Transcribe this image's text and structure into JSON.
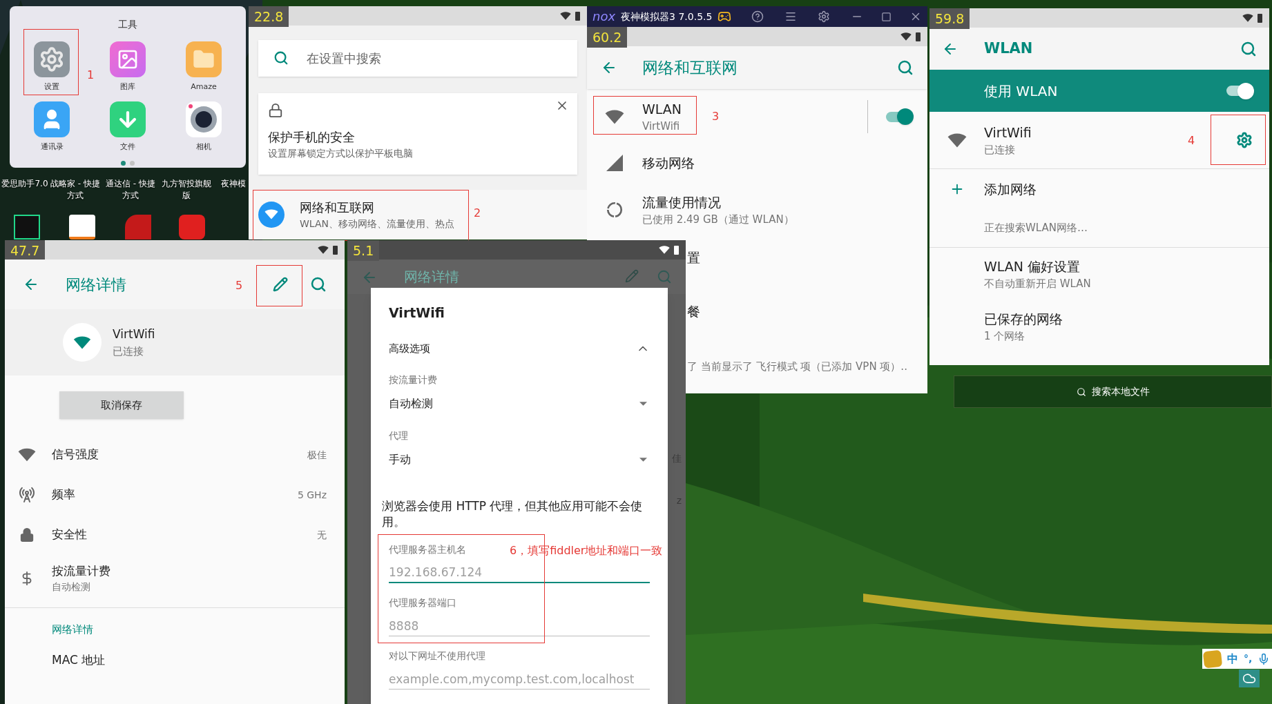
{
  "desktop": {
    "icon_labels": [
      "爱思助手7.0",
      "战略家 - 快捷方式",
      "通达信 - 快捷方式",
      "九方智投旗舰版",
      "夜神模"
    ],
    "apps": [
      {
        "kind": "pycharm"
      },
      {
        "kind": "arrow"
      },
      {
        "kind": "chart"
      },
      {
        "kind": "bull"
      }
    ],
    "search": {
      "placeholder": "搜索本地文件"
    }
  },
  "folder": {
    "title": "工具",
    "apps": [
      {
        "label": "设置",
        "kind": "gear"
      },
      {
        "label": "图库",
        "kind": "gallery"
      },
      {
        "label": "Amaze",
        "kind": "folder"
      },
      {
        "label": "通讯录",
        "kind": "contacts"
      },
      {
        "label": "文件",
        "kind": "download"
      },
      {
        "label": "相机",
        "kind": "camera"
      }
    ],
    "pages": [
      {
        "selected": true
      },
      {
        "selected": false
      }
    ],
    "annotation": "1"
  },
  "settings_window": {
    "fps": "22.8",
    "search": {
      "placeholder": "在设置中搜索"
    },
    "card": {
      "title": "保护手机的安全",
      "subtitle": "设置屏幕锁定方式以保护平板电脑"
    },
    "item": {
      "title": "网络和互联网",
      "subtitle": "WLAN、移动网络、流量使用、热点"
    },
    "annotation": "2"
  },
  "network_window": {
    "logo": "nox",
    "title": "夜神模拟器3 7.0.5.5",
    "fps": "60.2",
    "heading": "网络和互联网",
    "items": [
      {
        "kind": "wifi",
        "title": "WLAN",
        "subtitle": "VirtWifi",
        "on": true
      },
      {
        "kind": "cellular",
        "title": "移动网络"
      },
      {
        "kind": "usage",
        "title": "流量使用情况",
        "subtitle": "已使用 2.49 GB（通过 WLAN）"
      },
      {
        "kind": "fragment",
        "title": "置"
      },
      {
        "kind": "fragment",
        "title": "餐"
      }
    ],
    "footer": "了 当前显示了 飞行模式 项（已添加 VPN 项）..",
    "annotation": "3"
  },
  "wlan_window": {
    "fps": "59.8",
    "heading": "WLAN",
    "master": {
      "label": "使用 WLAN",
      "on": true
    },
    "network": {
      "name": "VirtWifi",
      "status": "已连接"
    },
    "annotation": "4",
    "add": "添加网络",
    "searching": "正在搜索WLAN网络…",
    "items": [
      {
        "title": "WLAN 偏好设置",
        "subtitle": "不自动重新开启 WLAN"
      },
      {
        "title": "已保存的网络",
        "subtitle": "1 个网络"
      }
    ]
  },
  "details_window": {
    "fps": "47.7",
    "heading": "网络详情",
    "annotation": "5",
    "network": {
      "name": "VirtWifi",
      "status": "已连接"
    },
    "forget_button": "取消保存",
    "rows": [
      {
        "kind": "signal",
        "label": "信号强度",
        "value": "极佳"
      },
      {
        "kind": "frequency",
        "label": "频率",
        "value": "5 GHz"
      },
      {
        "kind": "lock",
        "label": "安全性",
        "value": "无"
      },
      {
        "kind": "dollar",
        "label": "按流量计费",
        "subtitle": "自动检测"
      }
    ],
    "section": "网络详情",
    "mac": "MAC 地址"
  },
  "dialog_window": {
    "fps": "5.1",
    "heading": "网络详情",
    "behind_values": [
      "佳",
      "z"
    ],
    "dialog": {
      "title": "VirtWifi",
      "advanced": {
        "label": "高级选项",
        "expanded": true
      },
      "metered": {
        "label": "按流量计费",
        "value": "自动检测"
      },
      "proxy": {
        "label": "代理",
        "value": "手动"
      },
      "note": "浏览器会使用 HTTP 代理，但其他应用可能不会使用。",
      "fields": [
        {
          "label": "代理服务器主机名",
          "placeholder": "192.168.67.124",
          "focused": true
        },
        {
          "label": "代理服务器端口",
          "placeholder": "8888",
          "focused": false
        },
        {
          "label": "对以下网址不使用代理",
          "placeholder": "example.com,mycomp.test.com,localhost",
          "focused": false
        }
      ]
    },
    "annotation": "6，填写fiddler地址和端口一致"
  },
  "ime": {
    "language": "中",
    "punctuation": "°,"
  }
}
